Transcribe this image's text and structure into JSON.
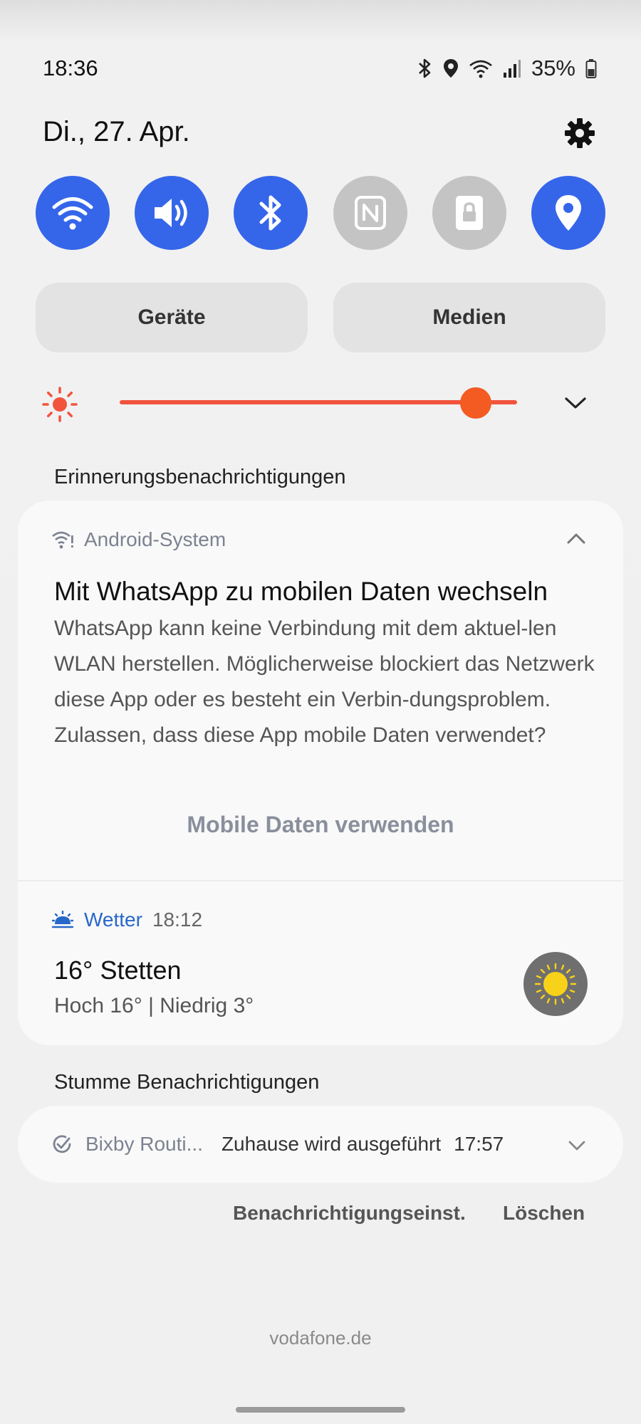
{
  "status_bar": {
    "time": "18:36",
    "battery": "35%",
    "icons": [
      "bluetooth-icon",
      "location-icon",
      "wifi-icon",
      "signal-icon",
      "battery-icon"
    ]
  },
  "header": {
    "date": "Di., 27. Apr.",
    "settings_icon": "gear-icon"
  },
  "quick_toggles": [
    {
      "icon": "wifi-icon",
      "state": "on"
    },
    {
      "icon": "sound-icon",
      "state": "on"
    },
    {
      "icon": "bluetooth-icon",
      "state": "on"
    },
    {
      "icon": "nfc-icon",
      "state": "off"
    },
    {
      "icon": "lock-icon",
      "state": "off"
    },
    {
      "icon": "location-icon",
      "state": "on"
    }
  ],
  "buttons": {
    "devices": "Geräte",
    "media": "Medien"
  },
  "brightness": {
    "level": 0.93,
    "color": "#f35b22"
  },
  "sections": {
    "alerting": "Erinnerungsbenachrichtigungen",
    "silent": "Stumme Benachrichtigungen"
  },
  "notification": {
    "app": "Android-System",
    "title": "Mit WhatsApp zu mobilen Daten wechseln",
    "body": "WhatsApp kann keine Verbindung mit dem aktuel-len WLAN herstellen. Möglicherweise blockiert das Netzwerk diese App oder es besteht ein Verbin-dungsproblem. Zulassen, dass diese App mobile Daten verwendet?",
    "action": "Mobile Daten verwenden"
  },
  "weather": {
    "app": "Wetter",
    "time": "18:12",
    "title": "16° Stetten",
    "subtitle": "Hoch 16° | Niedrig 3°"
  },
  "silent_notification": {
    "app": "Bixby Routi...",
    "text": "Zuhause wird ausgeführt",
    "time": "17:57"
  },
  "footer": {
    "settings": "Benachrichtigungseinst.",
    "clear": "Löschen"
  },
  "carrier": "vodafone.de",
  "colors": {
    "toggle_on": "#3566ea",
    "toggle_off": "#c4c4c4",
    "accent": "#f35b22",
    "weather_link": "#2767c9"
  }
}
